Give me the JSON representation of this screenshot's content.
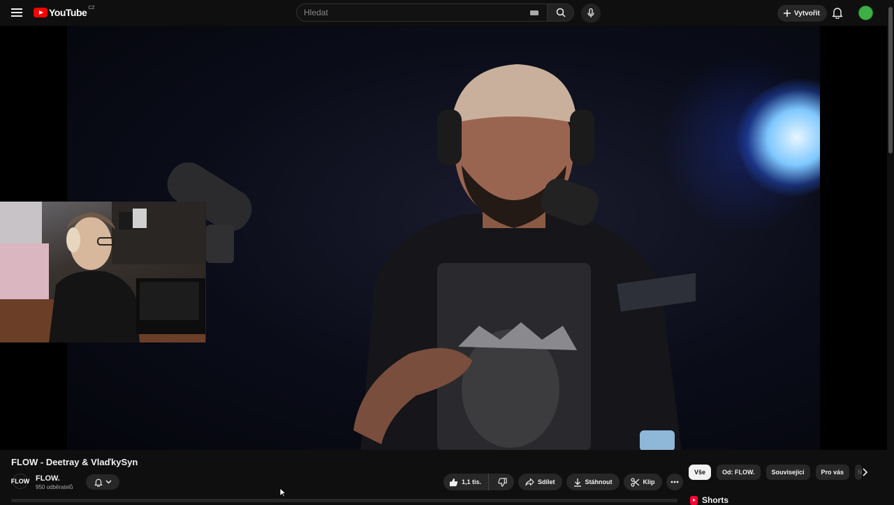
{
  "header": {
    "logo_text": "YouTube",
    "country_code": "CZ",
    "search_placeholder": "Hledat",
    "create_label": "Vytvořit"
  },
  "video": {
    "title": "FLOW - Deetray & VlaďkySyn",
    "channel_name": "FLOW.",
    "channel_avatar_text": "FLOW",
    "subscribers": "950 odběratelů"
  },
  "actions": {
    "likes": "1,1 tis.",
    "share": "Sdílet",
    "download": "Stáhnout",
    "clip": "Klip"
  },
  "chips": [
    {
      "label": "Vše",
      "active": true
    },
    {
      "label": "Od: FLOW.",
      "active": false
    },
    {
      "label": "Související",
      "active": false
    },
    {
      "label": "Pro vás",
      "active": false
    },
    {
      "label": "N",
      "active": false
    }
  ],
  "sidebar": {
    "shorts_label": "Shorts"
  },
  "colors": {
    "background": "#0f0f0f",
    "brand_red": "#ff0000",
    "pill": "#272727",
    "avatar_green": "#3cb043"
  }
}
